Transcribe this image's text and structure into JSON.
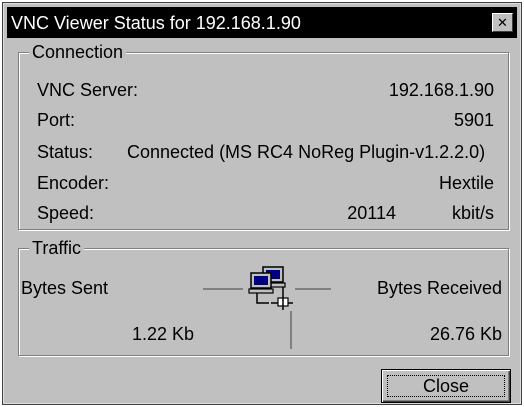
{
  "window": {
    "title": "VNC Viewer Status for 192.168.1.90",
    "close_glyph": "✕"
  },
  "connection": {
    "caption": "Connection",
    "server_label": "VNC Server:",
    "server_value": "192.168.1.90",
    "port_label": "Port:",
    "port_value": "5901",
    "status_label": "Status:",
    "status_value": "Connected (MS RC4 NoReg Plugin-v1.2.2.0)",
    "encoder_label": "Encoder:",
    "encoder_value": "Hextile",
    "speed_label": "Speed:",
    "speed_value": "20114",
    "speed_unit": "kbit/s"
  },
  "traffic": {
    "caption": "Traffic",
    "sent_label": "Bytes Sent",
    "sent_value": "1.22 Kb",
    "received_label": "Bytes Received",
    "received_value": "26.76 Kb",
    "icon": "network-computers-icon"
  },
  "buttons": {
    "close_label": "Close"
  }
}
